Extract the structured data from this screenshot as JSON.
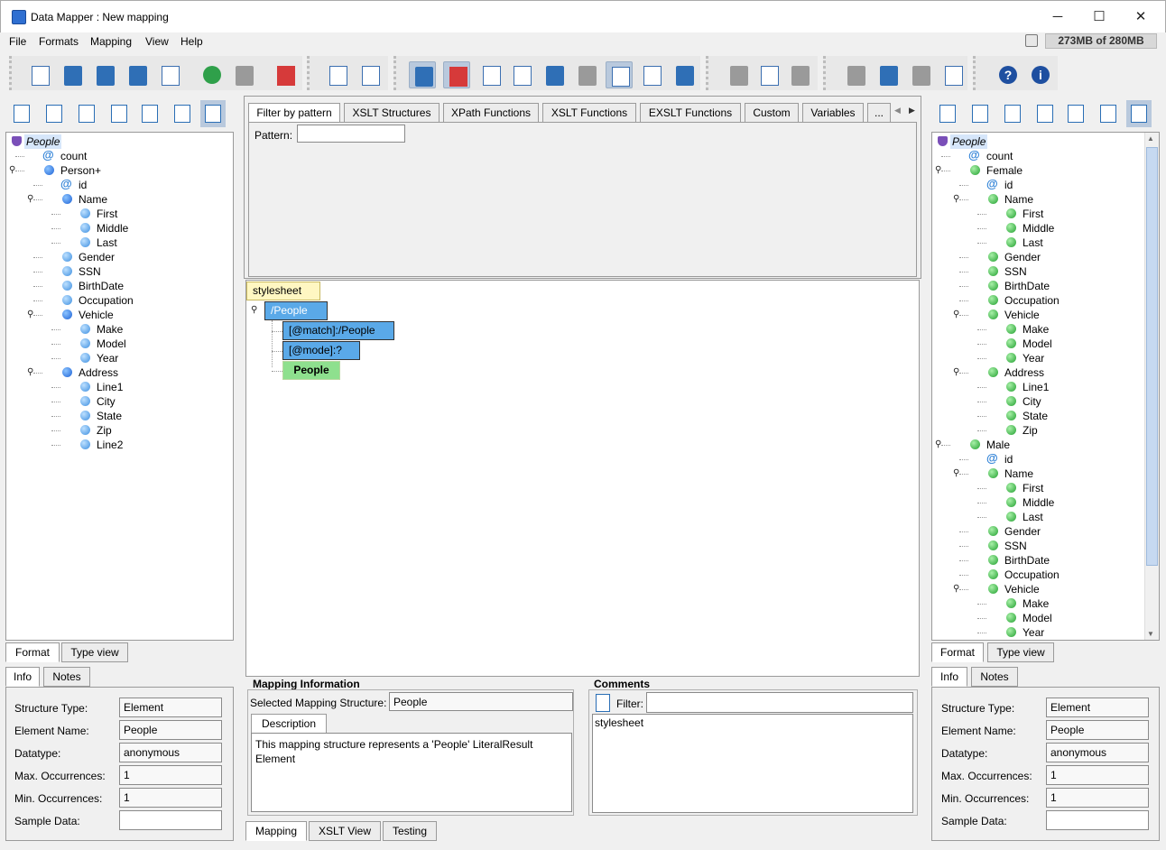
{
  "window": {
    "title": "Data Mapper : New mapping",
    "minimize": "─",
    "maximize": "☐",
    "close": "✕"
  },
  "menu": [
    "File",
    "Formats",
    "Mapping",
    "View",
    "Help"
  ],
  "memory": "273MB of 280MB",
  "toolbar": {
    "buttons": [
      "new-mapping",
      "open",
      "save",
      "save-as",
      "export-xls",
      "undo",
      "redo",
      "exit",
      "format-add",
      "format-settings",
      "info-view",
      "color-view",
      "list",
      "xml-code",
      "save-disk",
      "db-doc",
      "attribute",
      "table-map",
      "database",
      "cut",
      "copy",
      "paste",
      "move-left",
      "move-up",
      "remove",
      "list-color",
      "help",
      "info"
    ]
  },
  "left_panel": {
    "tree": [
      {
        "label": "People",
        "icon": "root",
        "level": 0,
        "expanded": true
      },
      {
        "label": "count",
        "icon": "attr",
        "level": 1
      },
      {
        "label": "Person+",
        "icon": "blue",
        "level": 1,
        "expanded": true
      },
      {
        "label": "id",
        "icon": "attr",
        "level": 2
      },
      {
        "label": "Name",
        "icon": "blue",
        "level": 2,
        "expanded": true
      },
      {
        "label": "First",
        "icon": "lblue",
        "level": 3
      },
      {
        "label": "Middle",
        "icon": "lblue",
        "level": 3
      },
      {
        "label": "Last",
        "icon": "lblue",
        "level": 3
      },
      {
        "label": "Gender",
        "icon": "lblue",
        "level": 2
      },
      {
        "label": "SSN",
        "icon": "lblue",
        "level": 2
      },
      {
        "label": "BirthDate",
        "icon": "lblue",
        "level": 2
      },
      {
        "label": "Occupation",
        "icon": "lblue",
        "level": 2
      },
      {
        "label": "Vehicle",
        "icon": "blue",
        "level": 2,
        "expanded": true
      },
      {
        "label": "Make",
        "icon": "lblue",
        "level": 3
      },
      {
        "label": "Model",
        "icon": "lblue",
        "level": 3
      },
      {
        "label": "Year",
        "icon": "lblue",
        "level": 3
      },
      {
        "label": "Address",
        "icon": "blue",
        "level": 2,
        "expanded": true
      },
      {
        "label": "Line1",
        "icon": "lblue",
        "level": 3
      },
      {
        "label": "City",
        "icon": "lblue",
        "level": 3
      },
      {
        "label": "State",
        "icon": "lblue",
        "level": 3
      },
      {
        "label": "Zip",
        "icon": "lblue",
        "level": 3
      },
      {
        "label": "Line2",
        "icon": "lblue",
        "level": 3
      }
    ],
    "bottom_tabs": [
      "Format",
      "Type view"
    ],
    "info_tabs": [
      "Info",
      "Notes"
    ],
    "info": {
      "structure_type_label": "Structure Type:",
      "structure_type": "Element",
      "element_name_label": "Element Name:",
      "element_name": "People",
      "datatype_label": "Datatype:",
      "datatype": "anonymous",
      "max_label": "Max. Occurrences:",
      "max": "1",
      "min_label": "Min. Occurrences:",
      "min": "1",
      "sample_label": "Sample Data:",
      "sample": ""
    }
  },
  "center": {
    "function_tabs": [
      "Filter by pattern",
      "XSLT Structures",
      "XPath Functions",
      "XSLT Functions",
      "EXSLT Functions",
      "Custom",
      "Variables",
      "..."
    ],
    "pattern_label": "Pattern:",
    "pattern_value": "",
    "mapping_boxes": [
      {
        "label": "stylesheet"
      },
      {
        "label": "/People"
      },
      {
        "label": "[@match]:/People"
      },
      {
        "label": "[@mode]:?"
      },
      {
        "label": "People"
      }
    ],
    "mapping_info_title": "Mapping Information",
    "selected_label": "Selected Mapping Structure:",
    "selected_value": "People",
    "description_tab": "Description",
    "description": "This mapping structure represents a 'People' LiteralResult Element",
    "comments_title": "Comments",
    "filter_label": "Filter:",
    "filter_value": "",
    "comment_item": "stylesheet",
    "bottom_tabs": [
      "Mapping",
      "XSLT View",
      "Testing"
    ]
  },
  "right_panel": {
    "tree": [
      {
        "label": "People",
        "icon": "root",
        "level": 0,
        "expanded": true
      },
      {
        "label": "count",
        "icon": "attr",
        "level": 1
      },
      {
        "label": "Female",
        "icon": "green",
        "level": 1,
        "expanded": true
      },
      {
        "label": "id",
        "icon": "attr",
        "level": 2
      },
      {
        "label": "Name",
        "icon": "green",
        "level": 2,
        "expanded": true
      },
      {
        "label": "First",
        "icon": "green",
        "level": 3
      },
      {
        "label": "Middle",
        "icon": "green",
        "level": 3
      },
      {
        "label": "Last",
        "icon": "green",
        "level": 3
      },
      {
        "label": "Gender",
        "icon": "green",
        "level": 2
      },
      {
        "label": "SSN",
        "icon": "green",
        "level": 2
      },
      {
        "label": "BirthDate",
        "icon": "green",
        "level": 2
      },
      {
        "label": "Occupation",
        "icon": "green",
        "level": 2
      },
      {
        "label": "Vehicle",
        "icon": "green",
        "level": 2,
        "expanded": true
      },
      {
        "label": "Make",
        "icon": "green",
        "level": 3
      },
      {
        "label": "Model",
        "icon": "green",
        "level": 3
      },
      {
        "label": "Year",
        "icon": "green",
        "level": 3
      },
      {
        "label": "Address",
        "icon": "green",
        "level": 2,
        "expanded": true
      },
      {
        "label": "Line1",
        "icon": "green",
        "level": 3
      },
      {
        "label": "City",
        "icon": "green",
        "level": 3
      },
      {
        "label": "State",
        "icon": "green",
        "level": 3
      },
      {
        "label": "Zip",
        "icon": "green",
        "level": 3
      },
      {
        "label": "Male",
        "icon": "green",
        "level": 1,
        "expanded": true
      },
      {
        "label": "id",
        "icon": "attr",
        "level": 2
      },
      {
        "label": "Name",
        "icon": "green",
        "level": 2,
        "expanded": true
      },
      {
        "label": "First",
        "icon": "green",
        "level": 3
      },
      {
        "label": "Middle",
        "icon": "green",
        "level": 3
      },
      {
        "label": "Last",
        "icon": "green",
        "level": 3
      },
      {
        "label": "Gender",
        "icon": "green",
        "level": 2
      },
      {
        "label": "SSN",
        "icon": "green",
        "level": 2
      },
      {
        "label": "BirthDate",
        "icon": "green",
        "level": 2
      },
      {
        "label": "Occupation",
        "icon": "green",
        "level": 2
      },
      {
        "label": "Vehicle",
        "icon": "green",
        "level": 2,
        "expanded": true
      },
      {
        "label": "Make",
        "icon": "green",
        "level": 3
      },
      {
        "label": "Model",
        "icon": "green",
        "level": 3
      },
      {
        "label": "Year",
        "icon": "green",
        "level": 3
      }
    ],
    "bottom_tabs": [
      "Format",
      "Type view"
    ],
    "info_tabs": [
      "Info",
      "Notes"
    ],
    "info": {
      "structure_type_label": "Structure Type:",
      "structure_type": "Element",
      "element_name_label": "Element Name:",
      "element_name": "People",
      "datatype_label": "Datatype:",
      "datatype": "anonymous",
      "max_label": "Max. Occurrences:",
      "max": "1",
      "min_label": "Min. Occurrences:",
      "min": "1",
      "sample_label": "Sample Data:",
      "sample": ""
    }
  },
  "colors": {
    "mapping_blue": "#5aa9e8",
    "mapping_green": "#8ee08e",
    "stylesheet_yellow": "#fff7c2",
    "selected_toolbar": "#b9c9dd"
  }
}
